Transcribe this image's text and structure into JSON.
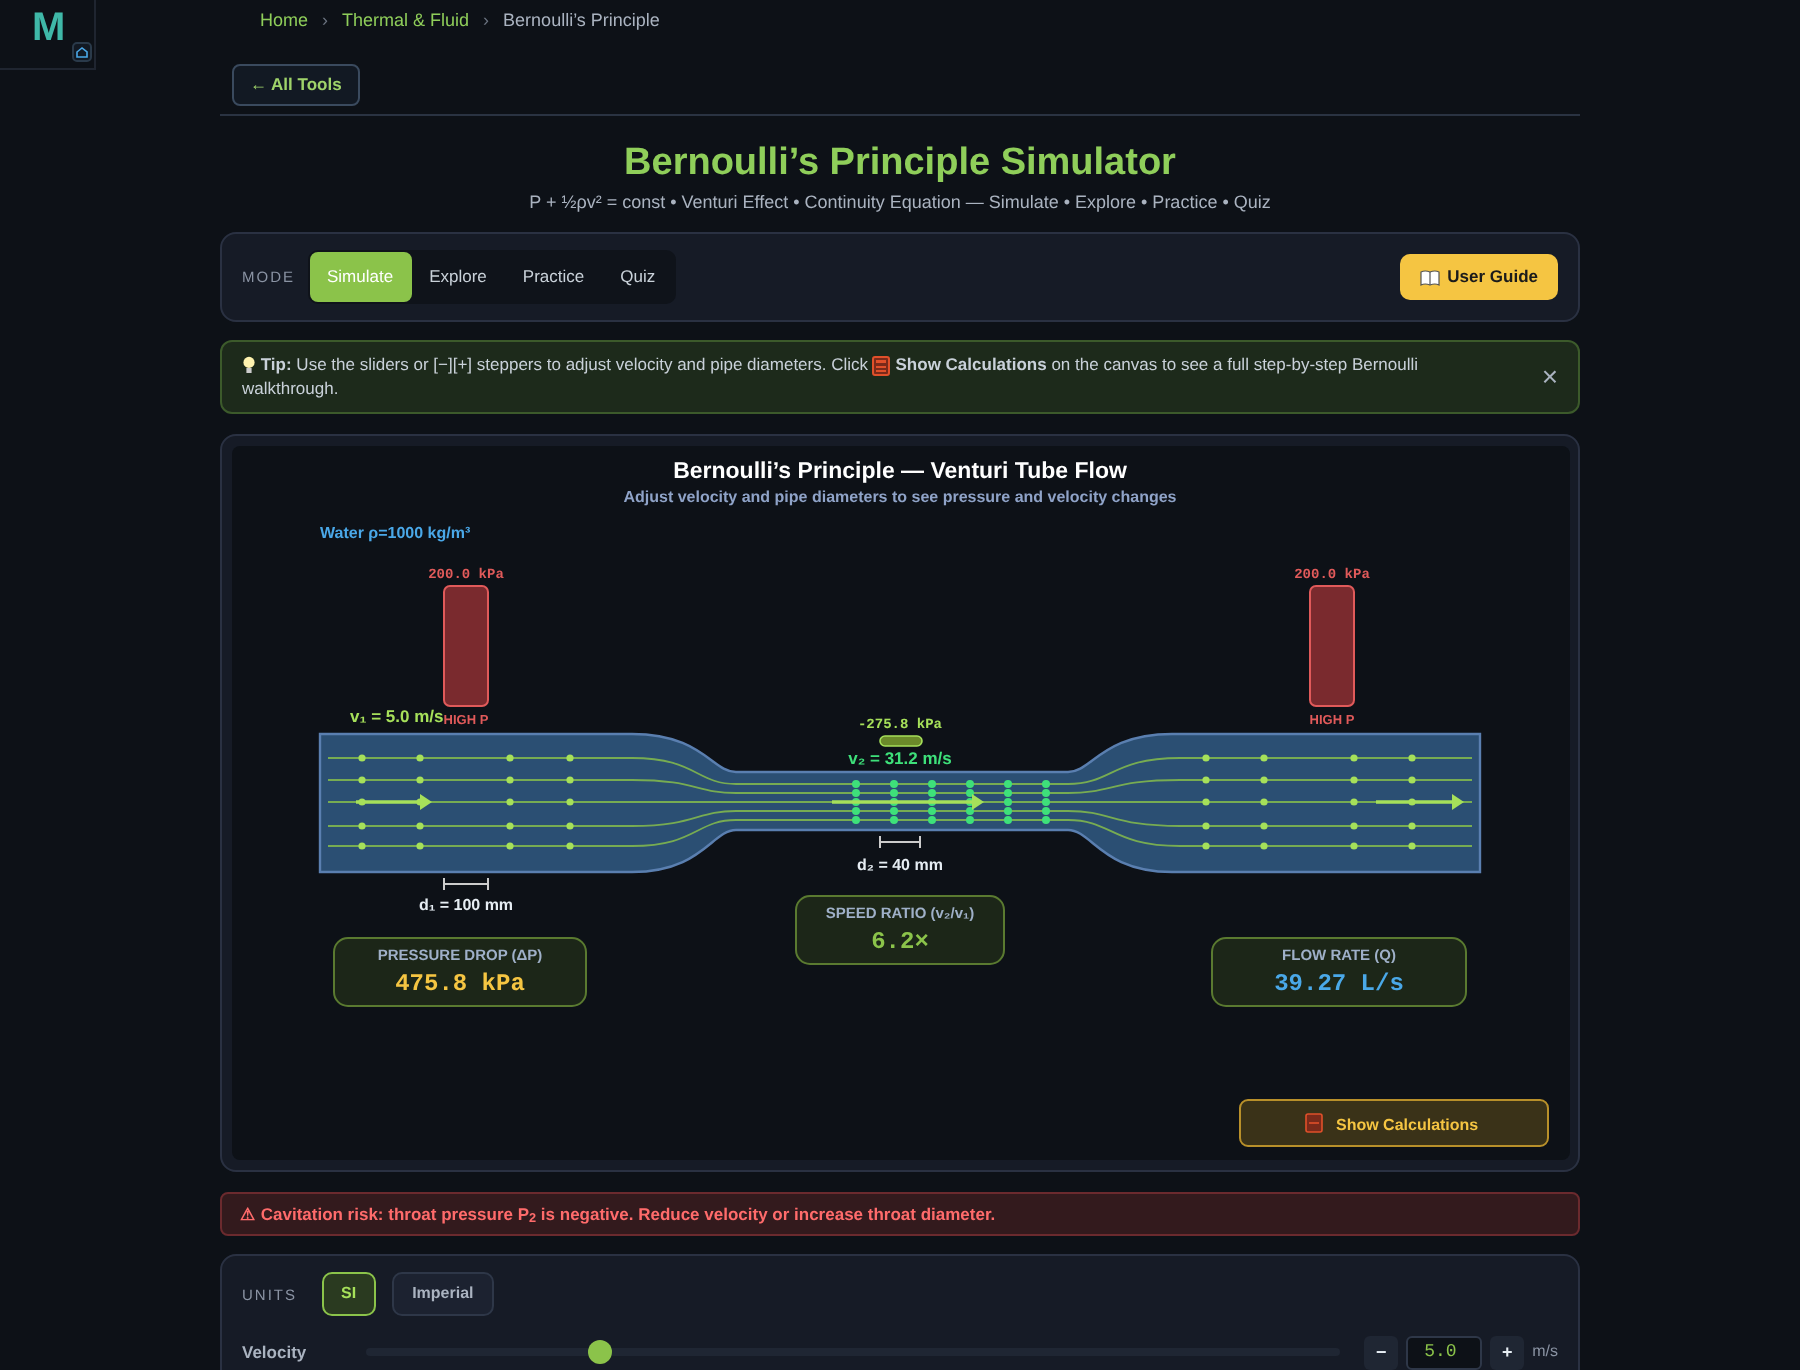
{
  "sidebar": {
    "logo": "M"
  },
  "breadcrumb": [
    {
      "label": "Home",
      "kind": "link"
    },
    {
      "separator": "›",
      "label": "Thermal & Fluid",
      "kind": "link"
    },
    {
      "separator": "›",
      "label": "Bernoulli’s Principle",
      "kind": "current"
    }
  ],
  "back_button": "← All Tools",
  "header": {
    "title": "Bernoulli’s Principle Simulator",
    "subtitle": "P + ½ρv² = const • Venturi Effect • Continuity Equation — Simulate • Explore • Practice • Quiz"
  },
  "mode_bar": {
    "label": "MODE",
    "tabs": [
      {
        "label": "Simulate",
        "selected": true
      },
      {
        "label": "Explore",
        "selected": false
      },
      {
        "label": "Practice",
        "selected": false
      },
      {
        "label": "Quiz",
        "selected": false
      }
    ],
    "guide_button": "User Guide"
  },
  "tip": {
    "text_before": "**Tip:** Use the sliders or [−][+] steppers to adjust velocity and pipe diameters. Click",
    "text_after": "**Show Calculations** on the canvas to see a full step-by-step Bernoulli",
    "text_end": "walkthrough.",
    "close": "×"
  },
  "canvas": {
    "title": "Bernoulli’s Principle — Venturi Tube Flow",
    "subtitle": "Adjust velocity and pipe diameters to see pressure and velocity changes",
    "fluid": "Water  ρ=1000 kg/m³",
    "gauges": [
      {
        "reading": "200.0 kPa",
        "label": "HIGH P"
      },
      {
        "reading": "200.0 kPa",
        "label": "HIGH P"
      }
    ],
    "v1": "v₁ = 5.0 m/s",
    "throat_pressure": "-275.8 kPa",
    "v2": "v₂ = 31.2 m/s",
    "d1": "d₁ = 100 mm",
    "d2": "d₂ = 40 mm",
    "stats": [
      {
        "label": "PRESSURE DROP (ΔP)",
        "value": "475.8 kPa",
        "kind": "pressure"
      },
      {
        "label": "SPEED RATIO (v₂/v₁)",
        "value": "6.2×",
        "kind": "ratio"
      },
      {
        "label": "FLOW RATE (Q)",
        "value": "39.27 L/s",
        "kind": "flow"
      }
    ],
    "calc_button": "Show Calculations"
  },
  "alert": "⚠ Cavitation risk: throat pressure P$_{2}$ is negative. Reduce velocity or increase throat diameter.",
  "units": {
    "label": "UNITS",
    "options": [
      {
        "label": "SI",
        "selected": true
      },
      {
        "label": "Imperial",
        "selected": false
      }
    ]
  },
  "controls": [
    {
      "label": "Velocity",
      "level": 0.24,
      "minus": "−",
      "value": "5.0",
      "plus": "+",
      "unit": "m/s"
    }
  ]
}
